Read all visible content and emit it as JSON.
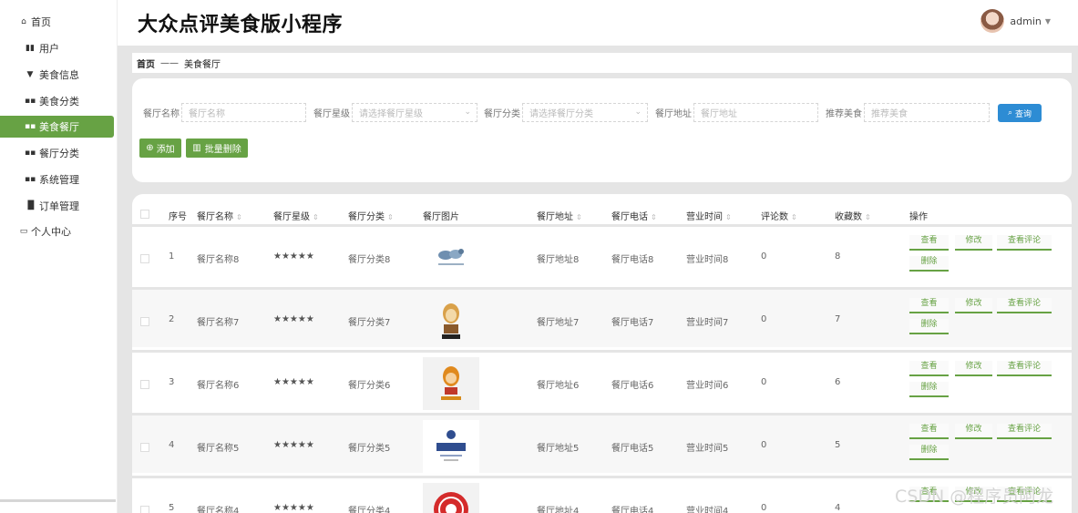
{
  "sidebar": {
    "items": [
      {
        "label": "首页",
        "icon": "home-icon",
        "glyph": "⌂"
      },
      {
        "label": "用户",
        "icon": "books-icon",
        "glyph": "▮▮"
      },
      {
        "label": "美食信息",
        "icon": "cup-icon",
        "glyph": "▼"
      },
      {
        "label": "美食分类",
        "icon": "grid-icon",
        "glyph": "▪▪"
      },
      {
        "label": "美食餐厅",
        "icon": "grid-icon",
        "glyph": "▪▪"
      },
      {
        "label": "餐厅分类",
        "icon": "grid-icon",
        "glyph": "▪▪"
      },
      {
        "label": "系统管理",
        "icon": "grid-icon",
        "glyph": "▪▪"
      },
      {
        "label": "订单管理",
        "icon": "bar-chart-icon",
        "glyph": "▐▌"
      },
      {
        "label": "个人中心",
        "icon": "window-icon",
        "glyph": "▭"
      }
    ],
    "active": "美食餐厅"
  },
  "header": {
    "title": "大众点评美食版小程序",
    "user": "admin"
  },
  "breadcrumb": {
    "home": "首页",
    "separator": "——",
    "current": "美食餐厅"
  },
  "search": {
    "fields": [
      {
        "label": "餐厅名称",
        "placeholder": "餐厅名称"
      },
      {
        "label": "餐厅星级",
        "placeholder": "请选择餐厅星级"
      },
      {
        "label": "餐厅分类",
        "placeholder": "请选择餐厅分类"
      },
      {
        "label": "餐厅地址",
        "placeholder": "餐厅地址"
      },
      {
        "label": "推荐美食",
        "placeholder": "推荐美食"
      }
    ],
    "search_label": "查询",
    "add_label": "添加",
    "batch_delete_label": "批量删除"
  },
  "table": {
    "headers": {
      "index": "序号",
      "name": "餐厅名称",
      "stars": "餐厅星级",
      "category": "餐厅分类",
      "image": "餐厅图片",
      "address": "餐厅地址",
      "phone": "餐厅电话",
      "hours": "营业时间",
      "comments": "评论数",
      "favorites": "收藏数",
      "actions": "操作"
    },
    "rows": [
      {
        "index": "1",
        "name": "餐厅名称8",
        "stars": "★★★★★",
        "category": "餐厅分类8",
        "address": "餐厅地址8",
        "phone": "餐厅电话8",
        "hours": "营业时间8",
        "comments": "0",
        "favorites": "8",
        "logo_text": "LOGO DESIGN"
      },
      {
        "index": "2",
        "name": "餐厅名称7",
        "stars": "★★★★★",
        "category": "餐厅分类7",
        "address": "餐厅地址7",
        "phone": "餐厅电话7",
        "hours": "营业时间7",
        "comments": "0",
        "favorites": "7",
        "logo_text": "董鲜人"
      },
      {
        "index": "3",
        "name": "餐厅名称6",
        "stars": "★★★★★",
        "category": "餐厅分类6",
        "address": "餐厅地址6",
        "phone": "餐厅电话6",
        "hours": "营业时间6",
        "comments": "0",
        "favorites": "6",
        "logo_text": "吃货餐厅"
      },
      {
        "index": "4",
        "name": "餐厅名称5",
        "stars": "★★★★★",
        "category": "餐厅分类5",
        "address": "餐厅地址5",
        "phone": "餐厅电话5",
        "hours": "营业时间5",
        "comments": "0",
        "favorites": "5",
        "logo_text": "环游餐厅"
      },
      {
        "index": "5",
        "name": "餐厅名称4",
        "stars": "★★★★★",
        "category": "餐厅分类4",
        "address": "餐厅地址4",
        "phone": "餐厅电话4",
        "hours": "营业时间4",
        "comments": "0",
        "favorites": "4",
        "logo_text": ""
      }
    ],
    "actions": {
      "view": "查看",
      "edit": "修改",
      "view_comments": "查看评论",
      "delete": "删除"
    }
  },
  "watermark": "CSDN @程序员阿龙",
  "colors": {
    "accent_green": "#67a244",
    "search_blue": "#2d8cd4",
    "background_gray": "#e5e5e5"
  }
}
